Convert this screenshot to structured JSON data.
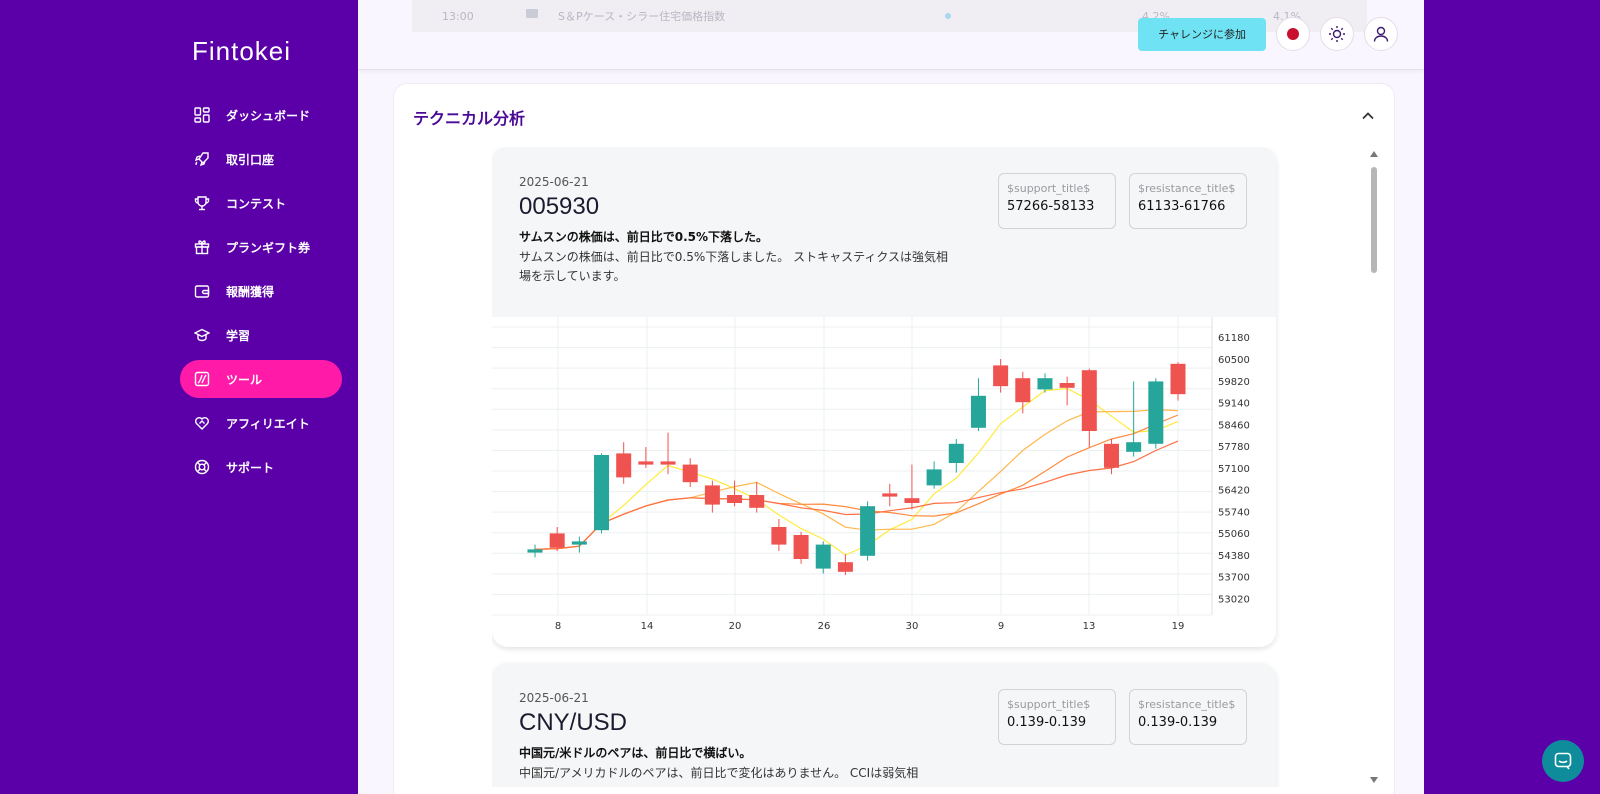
{
  "brand": {
    "logo_text": "Fintokei"
  },
  "sidebar": {
    "items": [
      {
        "label": "ダッシュボード",
        "icon": "dashboard-icon",
        "active": false
      },
      {
        "label": "取引口座",
        "icon": "rocket-icon",
        "active": false
      },
      {
        "label": "コンテスト",
        "icon": "trophy-icon",
        "active": false
      },
      {
        "label": "プランギフト券",
        "icon": "gift-icon",
        "active": false
      },
      {
        "label": "報酬獲得",
        "icon": "wallet-icon",
        "active": false
      },
      {
        "label": "学習",
        "icon": "graduation-cap-icon",
        "active": false
      },
      {
        "label": "ツール",
        "icon": "tools-icon",
        "active": true
      },
      {
        "label": "アフィリエイト",
        "icon": "heart-handshake-icon",
        "active": false
      },
      {
        "label": "サポート",
        "icon": "lifebuoy-icon",
        "active": false
      }
    ]
  },
  "topbar": {
    "challenge_button": "チャレンジに参加",
    "language_icon": "japan-flag-icon",
    "theme_icon": "sun-icon",
    "profile_icon": "user-icon"
  },
  "previous_row": {
    "time": "13:00",
    "event": "S＆Pケース・シラー住宅価格指数",
    "forecast": "4.2%",
    "previous": "4.1%"
  },
  "technical": {
    "title": "テクニカル分析",
    "cards": [
      {
        "date": "2025-06-21",
        "symbol": "005930",
        "headline": "サムスンの株価は、前日比で0.5%下落した。",
        "description": "サムスンの株価は、前日比で0.5%下落しました。 ストキャスティクスは強気相場を示しています。",
        "support_title": "$support_title$",
        "support_value": "57266-58133",
        "resistance_title": "$resistance_title$",
        "resistance_value": "61133-61766"
      },
      {
        "date": "2025-06-21",
        "symbol": "CNY/USD",
        "headline": "中国元/米ドルのペアは、前日比で横ばい。",
        "description": "中国元/アメリカドルのペアは、前日比で変化はありません。 CCIは弱気相",
        "support_title": "$support_title$",
        "support_value": "0.139-0.139",
        "resistance_title": "$resistance_title$",
        "resistance_value": "0.139-0.139"
      }
    ]
  },
  "chart_data": {
    "type": "candlestick",
    "x_tick_labels": [
      "8",
      "14",
      "20",
      "26",
      "30",
      "9",
      "13",
      "19"
    ],
    "y_tick_labels": [
      "61180",
      "60500",
      "59820",
      "59140",
      "58460",
      "57780",
      "57100",
      "56420",
      "55740",
      "55060",
      "54380",
      "53700",
      "53020"
    ],
    "ylim": [
      52500,
      61500
    ],
    "grid": true,
    "colors": {
      "up": "#26a69a",
      "down": "#ef5350",
      "ma_fast": "#ffeb3b",
      "ma_mid": "#ffb74d",
      "ma_slow": "#ff7043"
    },
    "candles": [
      {
        "open": 54450,
        "close": 54550,
        "high": 54700,
        "low": 54300
      },
      {
        "open": 55050,
        "close": 54600,
        "high": 55250,
        "low": 54500
      },
      {
        "open": 54700,
        "close": 54800,
        "high": 54950,
        "low": 54450
      },
      {
        "open": 55150,
        "close": 57500,
        "high": 57550,
        "low": 55050
      },
      {
        "open": 57550,
        "close": 56800,
        "high": 57900,
        "low": 56600
      },
      {
        "open": 57300,
        "close": 57200,
        "high": 57750,
        "low": 57100
      },
      {
        "open": 57300,
        "close": 57200,
        "high": 58200,
        "low": 56900
      },
      {
        "open": 57200,
        "close": 56650,
        "high": 57400,
        "low": 56500
      },
      {
        "open": 56550,
        "close": 55950,
        "high": 56700,
        "low": 55700
      },
      {
        "open": 56250,
        "close": 56000,
        "high": 56700,
        "low": 55900
      },
      {
        "open": 56250,
        "close": 55850,
        "high": 56650,
        "low": 55700
      },
      {
        "open": 55250,
        "close": 54700,
        "high": 55500,
        "low": 54500
      },
      {
        "open": 55000,
        "close": 54250,
        "high": 55100,
        "low": 54100
      },
      {
        "open": 53950,
        "close": 54700,
        "high": 54800,
        "low": 53800
      },
      {
        "open": 54150,
        "close": 53850,
        "high": 54400,
        "low": 53750
      },
      {
        "open": 54350,
        "close": 55900,
        "high": 56050,
        "low": 54200
      },
      {
        "open": 56300,
        "close": 56200,
        "high": 56600,
        "low": 55900
      },
      {
        "open": 56150,
        "close": 56000,
        "high": 57200,
        "low": 55800
      },
      {
        "open": 56550,
        "close": 57050,
        "high": 57300,
        "low": 56450
      },
      {
        "open": 57250,
        "close": 57850,
        "high": 58000,
        "low": 56950
      },
      {
        "open": 58350,
        "close": 59350,
        "high": 59900,
        "low": 58250
      },
      {
        "open": 60300,
        "close": 59650,
        "high": 60500,
        "low": 59450
      },
      {
        "open": 59900,
        "close": 59150,
        "high": 60100,
        "low": 58800
      },
      {
        "open": 59550,
        "close": 59900,
        "high": 60050,
        "low": 59450
      },
      {
        "open": 59750,
        "close": 59600,
        "high": 59950,
        "low": 59050
      },
      {
        "open": 60150,
        "close": 58250,
        "high": 60200,
        "low": 57750
      },
      {
        "open": 57850,
        "close": 57100,
        "high": 58000,
        "low": 56900
      },
      {
        "open": 57600,
        "close": 57900,
        "high": 59800,
        "low": 57450
      },
      {
        "open": 57850,
        "close": 59800,
        "high": 59900,
        "low": 57700
      },
      {
        "open": 60350,
        "close": 59400,
        "high": 60400,
        "low": 59200
      }
    ]
  }
}
